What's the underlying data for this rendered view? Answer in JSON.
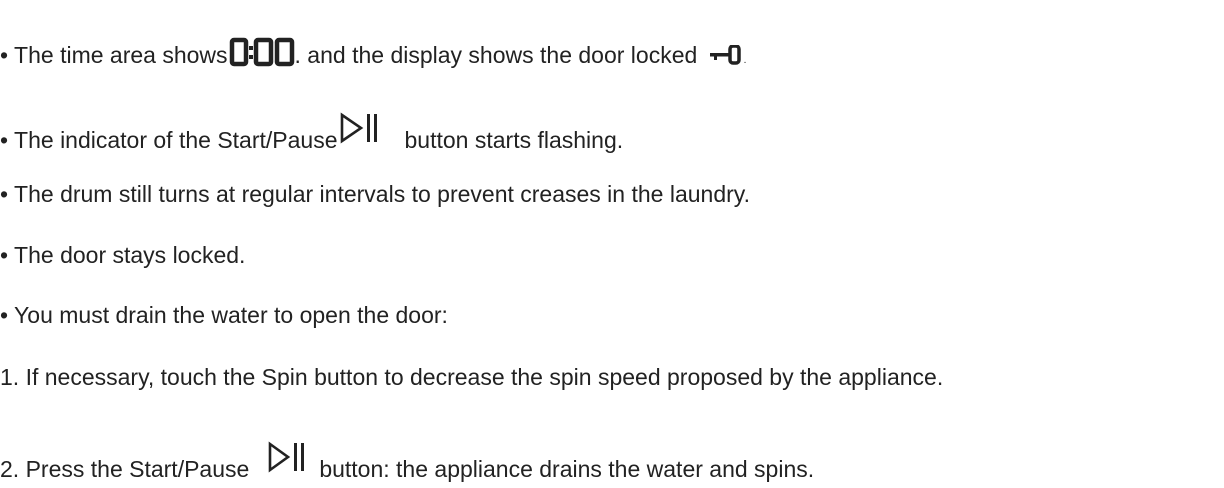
{
  "lines": [
    {
      "bullet": "•",
      "text_before": "The time area shows",
      "text_middle": ". and the display shows the door locked",
      "text_after": ".",
      "icons": [
        "time-zero-display-icon",
        "door-locked-key-icon"
      ]
    },
    {
      "bullet": "•",
      "text_before": "The indicator of the Start/Pause",
      "text_after": "button starts flashing.",
      "icons": [
        "start-pause-icon"
      ]
    },
    {
      "bullet": "•",
      "text": "The drum still turns at regular intervals to prevent creases in the laundry."
    },
    {
      "bullet": "•",
      "text": "The door stays locked."
    },
    {
      "bullet": "•",
      "text": "You must drain the water to open the door:"
    },
    {
      "number": "1.",
      "text": "If necessary, touch the Spin button to decrease the spin speed proposed by the appliance."
    },
    {
      "number": "2.",
      "text_before": "Press the Start/Pause",
      "text_after": "button: the appliance drains the water and spins.",
      "icons": [
        "start-pause-icon"
      ]
    }
  ]
}
